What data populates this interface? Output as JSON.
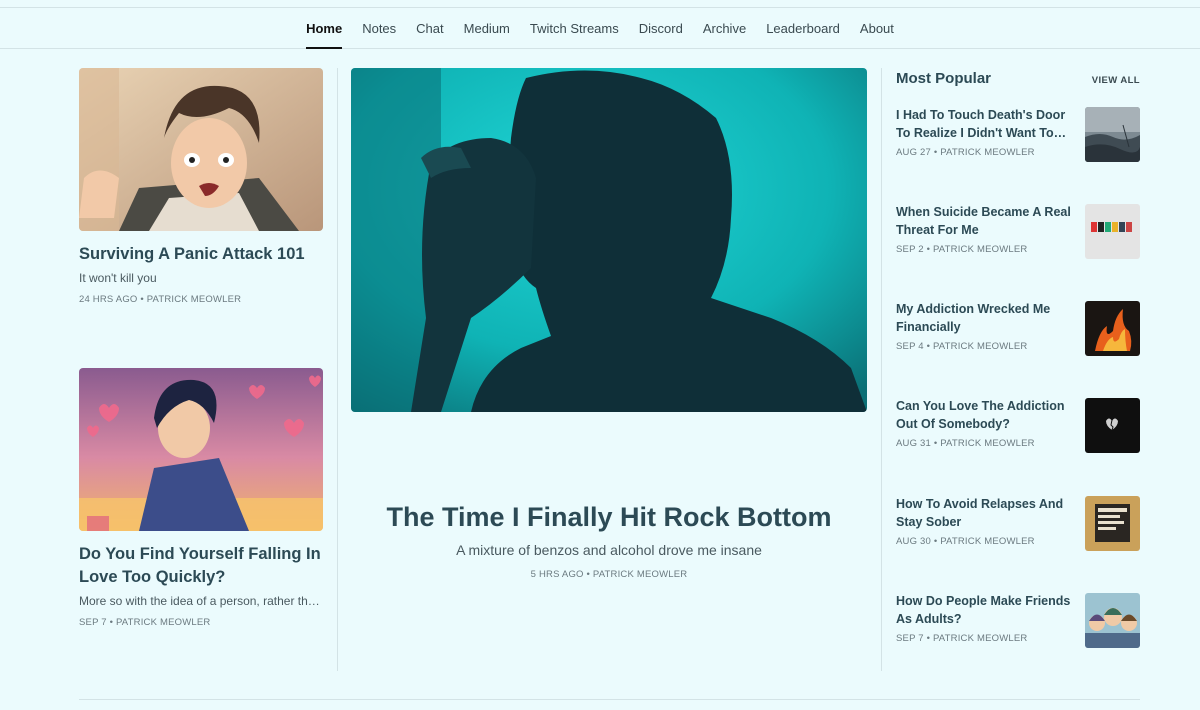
{
  "nav": {
    "items": [
      {
        "label": "Home",
        "active": true
      },
      {
        "label": "Notes"
      },
      {
        "label": "Chat"
      },
      {
        "label": "Medium"
      },
      {
        "label": "Twitch Streams"
      },
      {
        "label": "Discord"
      },
      {
        "label": "Archive"
      },
      {
        "label": "Leaderboard"
      },
      {
        "label": "About"
      }
    ]
  },
  "left_posts": [
    {
      "title": "Surviving A Panic Attack 101",
      "subtitle": "It won't kill you",
      "meta": "24 HRS AGO • PATRICK MEOWLER"
    },
    {
      "title": "Do You Find Yourself Falling In Love Too Quickly?",
      "subtitle": "More so with the idea of a person, rather than the person",
      "meta": "SEP 7 • PATRICK MEOWLER"
    }
  ],
  "hero": {
    "title": "The Time I Finally Hit Rock Bottom",
    "subtitle": "A mixture of benzos and alcohol drove me insane",
    "meta": "5 HRS AGO • PATRICK MEOWLER"
  },
  "sidebar": {
    "title": "Most Popular",
    "view_all": "VIEW ALL",
    "posts": [
      {
        "title": "I Had To Touch Death's Door To Realize I Didn't Want To Die",
        "meta": "AUG 27 • PATRICK MEOWLER"
      },
      {
        "title": "When Suicide Became A Real Threat For Me",
        "meta": "SEP 2 • PATRICK MEOWLER"
      },
      {
        "title": "My Addiction Wrecked Me Financially",
        "meta": "SEP 4 • PATRICK MEOWLER"
      },
      {
        "title": "Can You Love The Addiction Out Of Somebody?",
        "meta": "AUG 31 • PATRICK MEOWLER"
      },
      {
        "title": "How To Avoid Relapses And Stay Sober",
        "meta": "AUG 30 • PATRICK MEOWLER"
      },
      {
        "title": "How Do People Make Friends As Adults?",
        "meta": "SEP 7 • PATRICK MEOWLER"
      }
    ]
  },
  "colors": {
    "background": "#ebfbfd",
    "title_text": "#2c4a55",
    "hero_bg": "#12c4c4"
  }
}
